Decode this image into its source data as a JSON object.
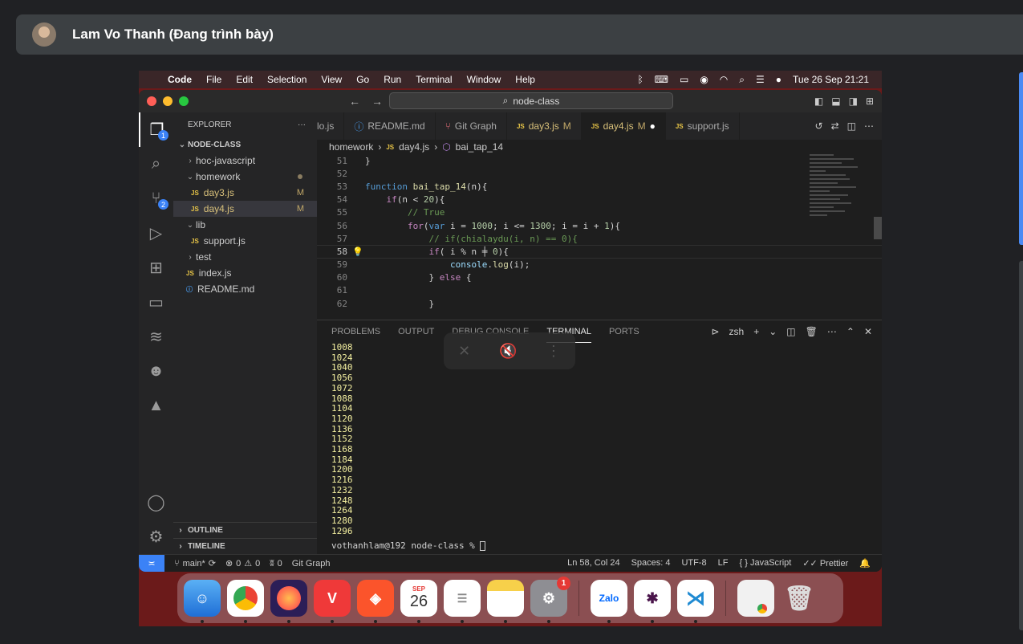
{
  "presenter": {
    "name": "Lam Vo Thanh (Đang trình bày)"
  },
  "menubar": {
    "app": "Code",
    "items": [
      "File",
      "Edit",
      "Selection",
      "View",
      "Go",
      "Run",
      "Terminal",
      "Window",
      "Help"
    ],
    "clock": "Tue 26 Sep  21:21"
  },
  "titlebar": {
    "search": "node-class"
  },
  "sidebar": {
    "title": "EXPLORER",
    "more": "···",
    "root": "NODE-CLASS",
    "tree": [
      {
        "label": "hoc-javascript",
        "kind": "folder-closed",
        "status": ""
      },
      {
        "label": "homework",
        "kind": "folder-open",
        "status": "dot"
      },
      {
        "label": "day3.js",
        "kind": "js",
        "status": "M"
      },
      {
        "label": "day4.js",
        "kind": "js",
        "status": "M"
      },
      {
        "label": "lib",
        "kind": "folder-open",
        "status": ""
      },
      {
        "label": "support.js",
        "kind": "js",
        "status": ""
      },
      {
        "label": "test",
        "kind": "folder-closed",
        "status": ""
      },
      {
        "label": "index.js",
        "kind": "js",
        "status": ""
      },
      {
        "label": "README.md",
        "kind": "md",
        "status": ""
      }
    ],
    "outline": "OUTLINE",
    "timeline": "TIMELINE"
  },
  "activity_badges": {
    "explorer": "1",
    "scm": "2"
  },
  "tabs": [
    {
      "label": "lo.js",
      "icon": "js",
      "status": ""
    },
    {
      "label": "README.md",
      "icon": "info",
      "status": ""
    },
    {
      "label": "Git Graph",
      "icon": "git",
      "status": ""
    },
    {
      "label": "day3.js",
      "icon": "js",
      "status": "M"
    },
    {
      "label": "day4.js",
      "icon": "js",
      "status": "M",
      "active": true
    },
    {
      "label": "support.js",
      "icon": "js",
      "status": ""
    }
  ],
  "breadcrumb": [
    "homework",
    "day4.js",
    "bai_tap_14"
  ],
  "code": {
    "lines": [
      {
        "n": "51",
        "t": "}"
      },
      {
        "n": "52",
        "t": ""
      },
      {
        "n": "53",
        "t": "function bai_tap_14(n){"
      },
      {
        "n": "54",
        "t": "    if(n < 20){"
      },
      {
        "n": "55",
        "t": "        // True"
      },
      {
        "n": "56",
        "t": "        for(var i = 1000; i <= 1300; i = i + 1){"
      },
      {
        "n": "57",
        "t": "            // if(chialaydu(i, n) == 0){"
      },
      {
        "n": "58",
        "t": "            if( i % n ╪ 0){"
      },
      {
        "n": "59",
        "t": "                console.log(i);"
      },
      {
        "n": "60",
        "t": "            } else {"
      },
      {
        "n": "61",
        "t": ""
      },
      {
        "n": "62",
        "t": "            }"
      }
    ],
    "current_line": "58"
  },
  "panel": {
    "tabs": [
      "PROBLEMS",
      "OUTPUT",
      "DEBUG CONSOLE",
      "TERMINAL",
      "PORTS"
    ],
    "active_tab": "TERMINAL",
    "shell": "zsh",
    "output": [
      "1008",
      "1024",
      "1040",
      "1056",
      "1072",
      "1088",
      "1104",
      "1120",
      "1136",
      "1152",
      "1168",
      "1184",
      "1200",
      "1216",
      "1232",
      "1248",
      "1264",
      "1280",
      "1296"
    ],
    "prompt": "vothanhlam@192 node-class % "
  },
  "statusbar": {
    "branch": "main*",
    "errors": "0",
    "warnings": "0",
    "ports": "0",
    "git_graph": "Git Graph",
    "position": "Ln 58, Col 24",
    "spaces": "Spaces: 4",
    "encoding": "UTF-8",
    "eol": "LF",
    "language": "JavaScript",
    "formatter": "Prettier"
  },
  "dock": {
    "calendar_month": "SEP",
    "calendar_day": "26",
    "settings_badge": "1",
    "zalo": "Zalo"
  },
  "colors": {
    "accent": "#3b82f6",
    "js_icon": "#e8c547",
    "modified": "#c2a868",
    "terminal_output": "#f4f0a0"
  }
}
